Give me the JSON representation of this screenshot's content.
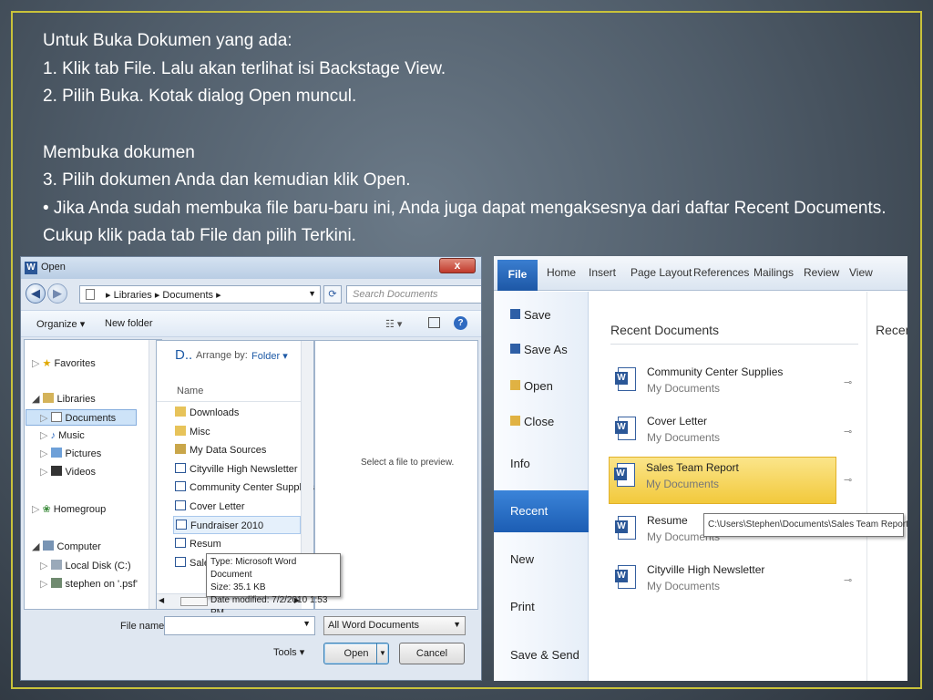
{
  "slide": {
    "lines": [
      "Untuk Buka Dokumen yang ada:",
      "1. Klik tab File. Lalu akan terlihat isi Backstage View.",
      "2. Pilih Buka. Kotak dialog Open muncul.",
      "Membuka dokumen",
      "3. Pilih dokumen Anda dan kemudian klik Open.",
      "• Jika Anda sudah membuka file baru-baru ini, Anda juga dapat mengaksesnya dari daftar Recent Documents. Cukup klik pada tab File dan pilih Terkini."
    ]
  },
  "open_dialog": {
    "title": "Open",
    "close": "x",
    "breadcrumb": "▸ Libraries ▸ Documents ▸",
    "search_placeholder": "Search Documents",
    "organize": "Organize ▾",
    "new_folder": "New folder",
    "nav": {
      "favorites": "Favorites",
      "libraries": "Libraries",
      "documents": "Documents",
      "music": "Music",
      "pictures": "Pictures",
      "videos": "Videos",
      "homegroup": "Homegroup",
      "computer": "Computer",
      "local_disk": "Local Disk (C:)",
      "network": "stephen on '.psf'"
    },
    "pane_heading": "D..",
    "arrange_by": "Arrange by:",
    "arrange_value": "Folder ▾",
    "col_name": "Name",
    "files": [
      "Downloads",
      "Misc",
      "My Data Sources",
      "Cityville High Newsletter",
      "Community Center Supplies",
      "Cover Letter",
      "Fundraiser 2010",
      "Resume",
      "Sales Team Report"
    ],
    "tooltip": {
      "type": "Type: Microsoft Word Document",
      "size": "Size: 35.1 KB",
      "date": "Date modified: 7/2/2010 1:53 PM"
    },
    "preview_text": "Select a file to preview.",
    "file_name_label": "File name:",
    "file_type": "All Word Documents",
    "tools": "Tools",
    "open_btn": "Open",
    "cancel_btn": "Cancel"
  },
  "backstage": {
    "tabs": [
      "File",
      "Home",
      "Insert",
      "Page Layout",
      "References",
      "Mailings",
      "Review",
      "View"
    ],
    "menu": [
      "Save",
      "Save As",
      "Open",
      "Close",
      "Info",
      "Recent",
      "New",
      "Print",
      "Save & Send"
    ],
    "recent_heading": "Recent Documents",
    "recent_heading_2": "Recent",
    "docs": [
      {
        "name": "Community Center Supplies",
        "path": "My Documents"
      },
      {
        "name": "Cover Letter",
        "path": "My Documents"
      },
      {
        "name": "Sales Team Report",
        "path": "My Documents"
      },
      {
        "name": "Resume",
        "path": "My Documents"
      },
      {
        "name": "Cityville High Newsletter",
        "path": "My Documents"
      }
    ],
    "path_tooltip": "C:\\Users\\Stephen\\Documents\\Sales Team Report.docx"
  },
  "colors": {
    "frame": "#c9c23a",
    "selected_tab": "#1d57a6",
    "highlight": "#f6d44a"
  }
}
